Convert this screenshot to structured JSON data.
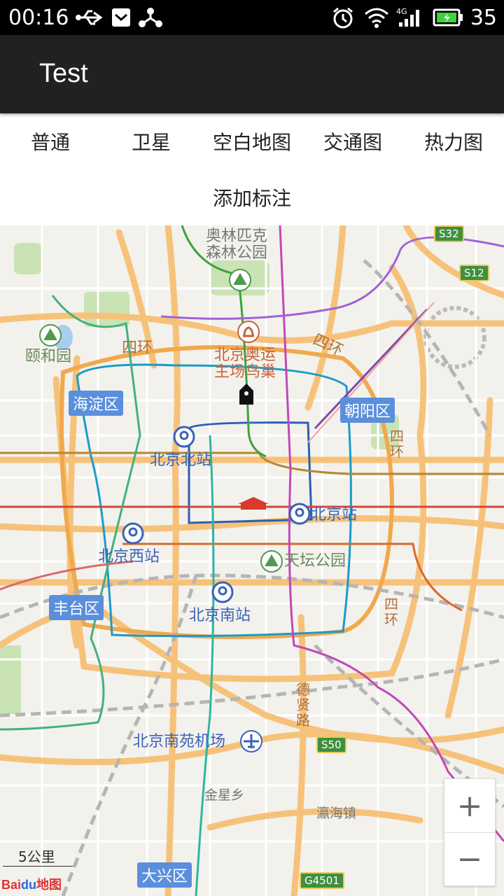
{
  "status_bar": {
    "time": "00:16",
    "battery": "35",
    "icons": [
      "usb-icon",
      "mail-icon",
      "share-icon",
      "alarm-icon",
      "wifi-icon",
      "signal-4g-icon",
      "battery-icon"
    ]
  },
  "app_bar": {
    "title": "Test"
  },
  "tabs": [
    {
      "label": "普通"
    },
    {
      "label": "卫星"
    },
    {
      "label": "空白地图"
    },
    {
      "label": "交通图"
    },
    {
      "label": "热力图"
    }
  ],
  "add_annotation": {
    "label": "添加标注"
  },
  "map": {
    "labels": {
      "olympic_forest": "奥林匹克\n森林公园",
      "summer_palace": "颐和园",
      "fourth_ring_w": "四环",
      "fourth_ring_n": "四环",
      "fourth_ring_e": "四环",
      "fourth_ring_se": "四环",
      "bird_nest": "北京奥运\n主场鸟巢",
      "beijing_north": "北京北站",
      "beijing_station": "北京站",
      "beijing_west": "北京西站",
      "temple_of_heaven": "天坛公园",
      "beijing_south": "北京南站",
      "deshen_road": "德贤路",
      "nanyuan_airport": "北京南苑机场",
      "jinxing": "金星乡",
      "yinghai": "瀛海镇"
    },
    "districts": {
      "haidian": "海淀区",
      "chaoyang": "朝阳区",
      "fengtai": "丰台区",
      "daxing": "大兴区"
    },
    "highways": {
      "s32": "S32",
      "s12": "S12",
      "s50": "S50",
      "g4501": "G4501"
    },
    "scale": "5公里",
    "logo_bai": "Bai",
    "logo_du": "du",
    "logo_map": "地图",
    "zoom_in": "+",
    "zoom_out": "−"
  }
}
